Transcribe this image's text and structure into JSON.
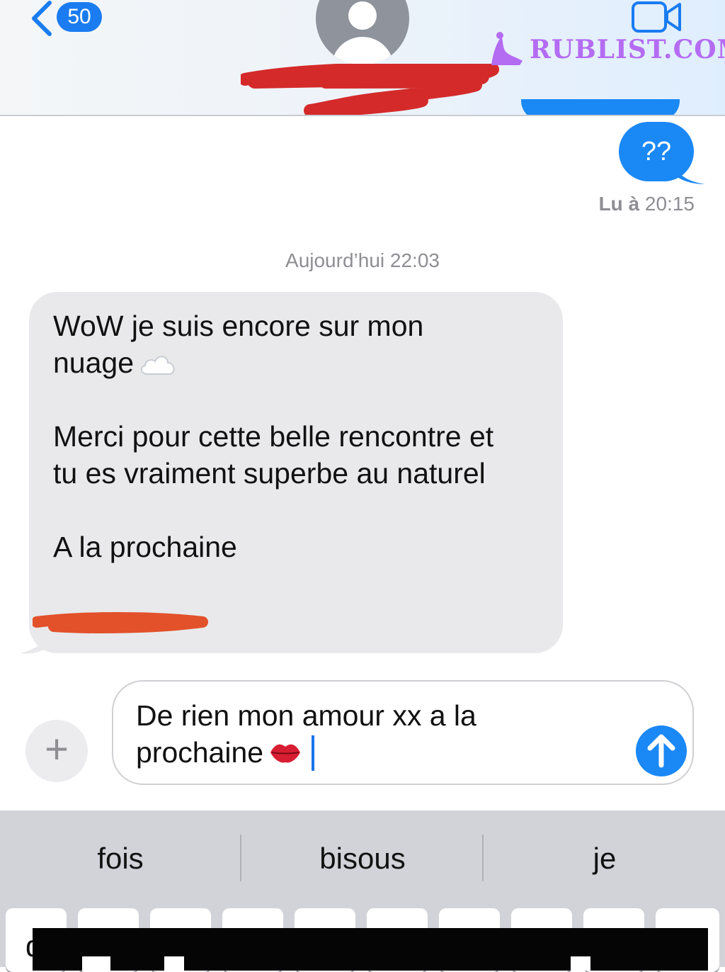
{
  "header": {
    "back_badge_count": "50",
    "watermark_text": "RUBLIST.COM"
  },
  "thread": {
    "sent_message": "??",
    "read_receipt_prefix": "Lu à",
    "read_receipt_time": "20:15",
    "timestamp": "Aujourd’hui 22:03",
    "received_lines": [
      "WoW je suis encore sur mon",
      "nuage",
      "Merci pour cette belle rencontre et",
      "tu es vraiment superbe au naturel",
      "A la prochaine"
    ]
  },
  "composer": {
    "plus_label": "+",
    "draft_line1": "De rien mon amour xx a la",
    "draft_line2": "prochaine"
  },
  "keyboard": {
    "suggestions": [
      "fois",
      "bisous",
      "je"
    ],
    "partial_key_char": "q"
  },
  "colors": {
    "accent_blue": "#1a88f5",
    "received_bubble": "#e9e9eb",
    "watermark": "#b46cf2",
    "redaction_red": "#d42a2a",
    "redaction_orange": "#e2512a"
  }
}
